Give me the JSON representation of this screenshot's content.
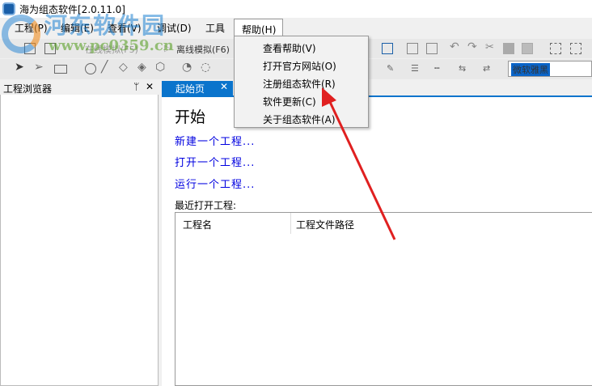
{
  "window": {
    "title": "海为组态软件[2.0.11.0]"
  },
  "menubar": [
    "工程(P)",
    "编辑(E)",
    "查看(V)",
    "调试(D)",
    "工具",
    "帮助(H)"
  ],
  "help_menu": [
    "查看帮助(V)",
    "打开官方网站(O)",
    "注册组态软件(R)",
    "软件更新(C)",
    "关于组态软件(A)"
  ],
  "toolbar": {
    "online_sim": "在线模拟(F5)",
    "offline_sim": "离线模拟(F6)",
    "font": "微软雅黑"
  },
  "left_panel": {
    "title": "工程浏览器",
    "pin": "ᛘ",
    "close": "✕"
  },
  "tab": {
    "label": "起始页",
    "close": "✕"
  },
  "start": {
    "heading": "开始",
    "links": [
      "新建一个工程...",
      "打开一个工程...",
      "运行一个工程..."
    ],
    "recent_label": "最近打开工程:",
    "columns": [
      "工程名",
      "工程文件路径"
    ]
  },
  "watermark": {
    "name": "河东软件园",
    "url": "www.pc0359.cn"
  },
  "colors": {
    "accent": "#0a74cc",
    "link": "#0000e0",
    "arrow": "#e02020"
  }
}
